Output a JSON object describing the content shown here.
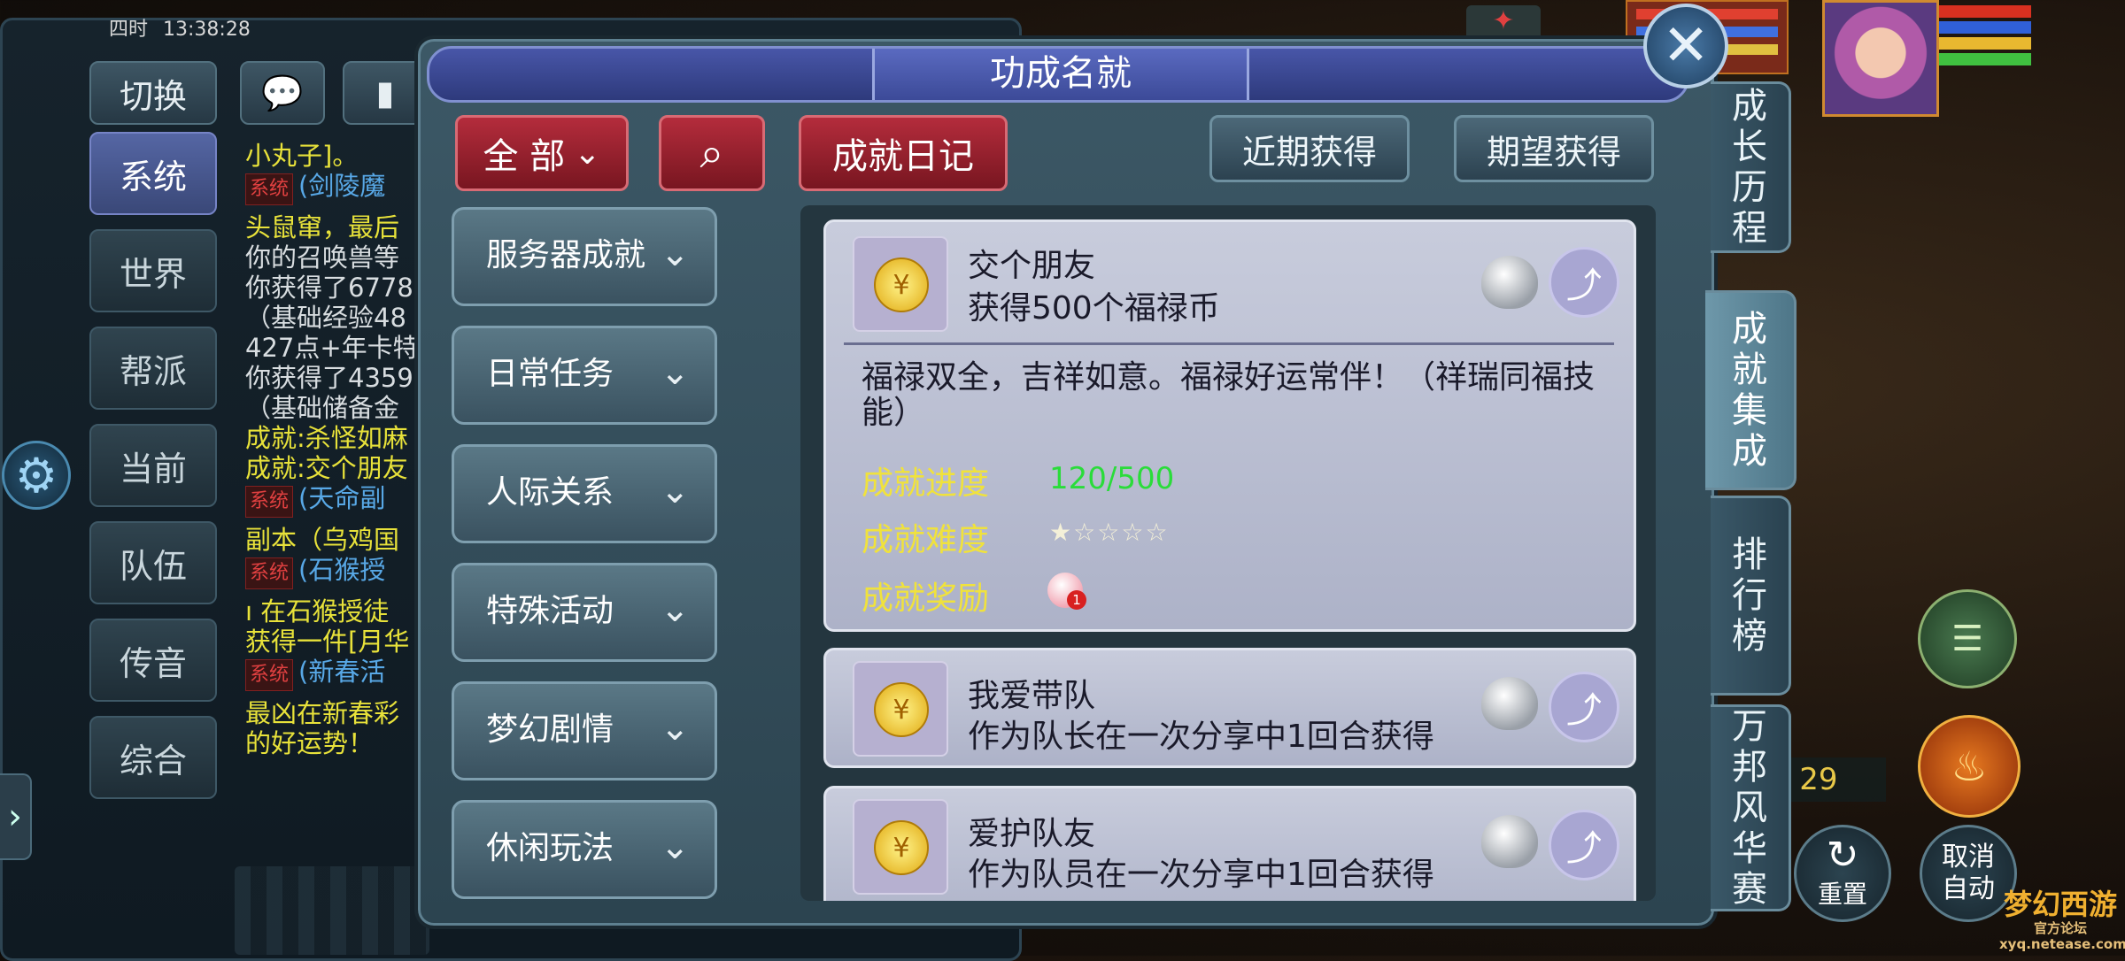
{
  "status_bar": {
    "left": "四时",
    "time": "13:38:28"
  },
  "chat": {
    "top_switch": "切换",
    "channels": [
      "系统",
      "世界",
      "帮派",
      "当前",
      "队伍",
      "传音",
      "综合"
    ],
    "active_channel": "系统",
    "lines": [
      {
        "tag": "",
        "text": "小丸子]。",
        "color": "c-yellow"
      },
      {
        "tag": "系统",
        "text": "(剑陵魔",
        "color": "c-blue"
      },
      {
        "tag": "",
        "text": "头鼠窜，最后",
        "color": "c-yellow"
      },
      {
        "tag": "",
        "text": "你的召唤兽等",
        "color": "c-white"
      },
      {
        "tag": "",
        "text": "你获得了6778",
        "color": "c-white"
      },
      {
        "tag": "",
        "text": "（基础经验48",
        "color": "c-white"
      },
      {
        "tag": "",
        "text": "427点+年卡特",
        "color": "c-white"
      },
      {
        "tag": "",
        "text": "你获得了4359",
        "color": "c-white"
      },
      {
        "tag": "",
        "text": "（基础储备金",
        "color": "c-white"
      },
      {
        "tag": "",
        "text": "成就:杀怪如麻",
        "color": "c-yellow"
      },
      {
        "tag": "",
        "text": "成就:交个朋友",
        "color": "c-yellow"
      },
      {
        "tag": "系统",
        "text": "(天命副",
        "color": "c-blue"
      },
      {
        "tag": "",
        "text": "副本（乌鸡国",
        "color": "c-yellow"
      },
      {
        "tag": "系统",
        "text": "(石猴授",
        "color": "c-blue"
      },
      {
        "tag": "",
        "text": "ı 在石猴授徒",
        "color": "c-yellow"
      },
      {
        "tag": "",
        "text": "获得一件[月华",
        "color": "c-yellow"
      },
      {
        "tag": "系统",
        "text": "(新春活",
        "color": "c-blue"
      },
      {
        "tag": "",
        "text": "最凶在新春彩",
        "color": "c-yellow"
      },
      {
        "tag": "",
        "text": "的好运势！",
        "color": "c-yellow"
      }
    ]
  },
  "dialog": {
    "title": "功成名就",
    "filter_label": "全 部",
    "diary_label": "成就日记",
    "recent_label": "近期获得",
    "expect_label": "期望获得",
    "categories": [
      "服务器成就",
      "日常任务",
      "人际关系",
      "特殊活动",
      "梦幻剧情",
      "休闲玩法"
    ]
  },
  "cards": [
    {
      "name": "交个朋友",
      "desc": "获得500个福禄币",
      "detail": "福禄双全，吉祥如意。福禄好运常伴！（祥瑞同福技能）",
      "progress_label": "成就进度",
      "progress_text": "120/500",
      "progress": 0.24,
      "difficulty_label": "成就难度",
      "difficulty_stars": 1,
      "difficulty_total": 5,
      "reward_label": "成就奖励",
      "reward_count": "1"
    },
    {
      "name": "我爱带队",
      "desc": "作为队长在一次分享中1回合获得"
    },
    {
      "name": "爱护队友",
      "desc": "作为队员在一次分享中1回合获得"
    }
  ],
  "side_tabs": [
    "成长历程",
    "成就集成",
    "排行榜",
    "万邦风华赛"
  ],
  "active_side_tab": "成就集成",
  "hud": {
    "turn_prefix": ":",
    "turn_count": "29",
    "reset_label": "重置",
    "cancel_auto_label": "取消自动",
    "logo_text": "梦幻西游",
    "logo_sub": "官方论坛",
    "logo_url": "xyq.netease.com"
  },
  "colors": {
    "accent_red": "#b42c3c",
    "title_blue": "#4856a8",
    "progress_green": "#2adc3a",
    "label_yellow": "#f0e23c"
  }
}
